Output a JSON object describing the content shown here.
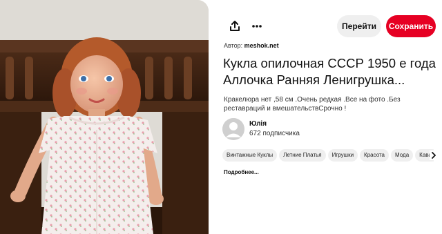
{
  "pin": {
    "image_alt": "Doll in pink floral dress",
    "author_prefix": "Автор:",
    "author_site": "meshok.net",
    "title_line1": "Кукла опилочная СССР 1950 е года",
    "title_line2": "Аллочка Ранняя Ленигрушка...",
    "description": "Кракелюра нет ,58 см .Очень редкая .Все на фото .Без реставраций и вмешательствСрочно !"
  },
  "toolbar": {
    "share_icon": "share-icon",
    "more_icon": "more-icon",
    "visit_label": "Перейти",
    "save_label": "Сохранить",
    "save_color": "#e60023"
  },
  "user": {
    "name": "Юлія",
    "followers": "672 подписчика"
  },
  "tags": [
    "Винтажные Куклы",
    "Летние Платья",
    "Игрушки",
    "Красота",
    "Мода",
    "Кавай"
  ],
  "more_link": "Подробнее..."
}
